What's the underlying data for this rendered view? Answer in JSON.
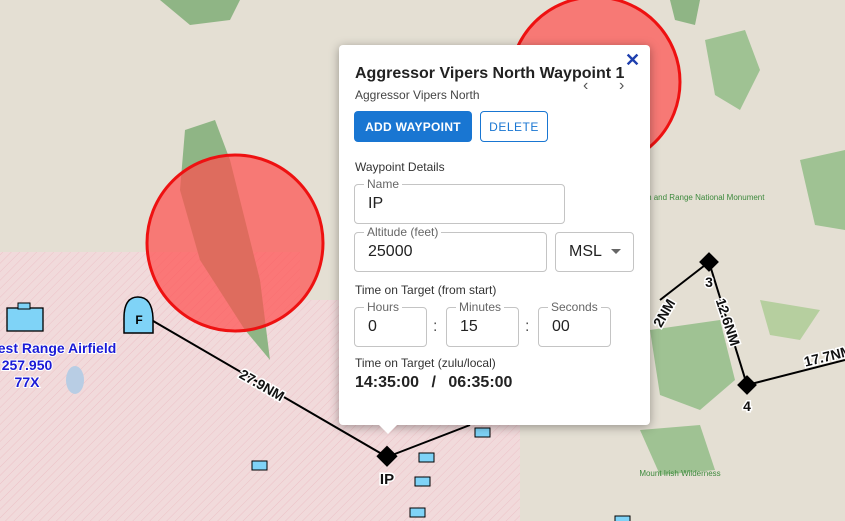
{
  "popup": {
    "title": "Aggressor Vipers North Waypoint 1",
    "subtitle": "Aggressor Vipers North",
    "close_glyph": "✕",
    "prev_glyph": "‹",
    "next_glyph": "›",
    "add_waypoint_label": "ADD WAYPOINT",
    "delete_label": "DELETE",
    "details_heading": "Waypoint Details",
    "name_label": "Name",
    "name_value": "IP",
    "altitude_label": "Altitude (feet)",
    "altitude_value": "25000",
    "altitude_ref": "MSL",
    "tot_heading": "Time on Target (from start)",
    "hours_label": "Hours",
    "hours_value": "0",
    "minutes_label": "Minutes",
    "minutes_value": "15",
    "seconds_label": "Seconds",
    "seconds_value": "00",
    "tot_zulu_heading": "Time on Target (zulu/local)",
    "zulu_time": "14:35:00",
    "separator": "/",
    "local_time": "06:35:00"
  },
  "map": {
    "route_color": "#000000",
    "threat_color": "#ff4444",
    "airfield": {
      "name": "Nellis Test Range Airfield",
      "display_name": "est Range Airfield",
      "frequency": "257.950",
      "tacan": "77X",
      "label_color": "#1a1ad6"
    },
    "marker_f_label": "F",
    "waypoints": [
      {
        "label": "IP"
      },
      {
        "label": "3"
      },
      {
        "label": "4"
      }
    ],
    "leg_labels": [
      "27.9NM",
      "12.6NM",
      "17.7NM",
      "2NM"
    ],
    "park_labels": [
      "Basin and Range National Monument",
      "Mount Irish Wilderness"
    ]
  }
}
